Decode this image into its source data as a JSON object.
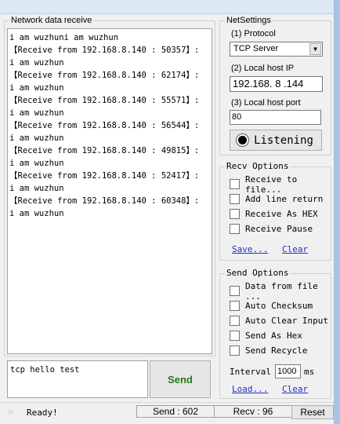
{
  "receive_panel": {
    "title": "Network data receive",
    "lines": [
      "i am wuzhuni am wuzhun",
      "【Receive from 192.168.8.140 : 50357】:",
      "i am wuzhun",
      "【Receive from 192.168.8.140 : 62174】:",
      "i am wuzhun",
      "【Receive from 192.168.8.140 : 55571】:",
      "i am wuzhun",
      "【Receive from 192.168.8.140 : 56544】:",
      "i am wuzhun",
      "【Receive from 192.168.8.140 : 49815】:",
      "i am wuzhun",
      "【Receive from 192.168.8.140 : 52417】:",
      "i am wuzhun",
      "【Receive from 192.168.8.140 : 60348】:",
      "i am wuzhun"
    ]
  },
  "net_settings": {
    "title": "NetSettings",
    "protocol_label": "(1) Protocol",
    "protocol_value": "TCP Server",
    "local_ip_label": "(2) Local host IP",
    "local_ip_value": "192.168. 8 .144",
    "local_port_label": "(3) Local host port",
    "local_port_value": "80",
    "listen_button": "Listening"
  },
  "recv_options": {
    "title": "Recv Options",
    "items": [
      "Receive to file...",
      "Add line return",
      "Receive As HEX",
      "Receive Pause"
    ],
    "save_link": "Save...",
    "clear_link": "Clear"
  },
  "send_options": {
    "title": "Send Options",
    "items": [
      "Data from file ...",
      "Auto Checksum",
      "Auto Clear Input",
      "Send As Hex",
      "Send Recycle"
    ],
    "interval_label": "Interval",
    "interval_value": "1000",
    "interval_unit": "ms",
    "load_link": "Load...",
    "clear_link": "Clear"
  },
  "send_box": {
    "text": "tcp hello test",
    "send_button": "Send"
  },
  "status_bar": {
    "ready": "Ready!",
    "send_count": "Send : 602",
    "recv_count": "Recv : 96",
    "reset_button": "Reset"
  },
  "colors": {
    "send_button_text": "#1e7a1e",
    "link": "#1a2fd1"
  }
}
